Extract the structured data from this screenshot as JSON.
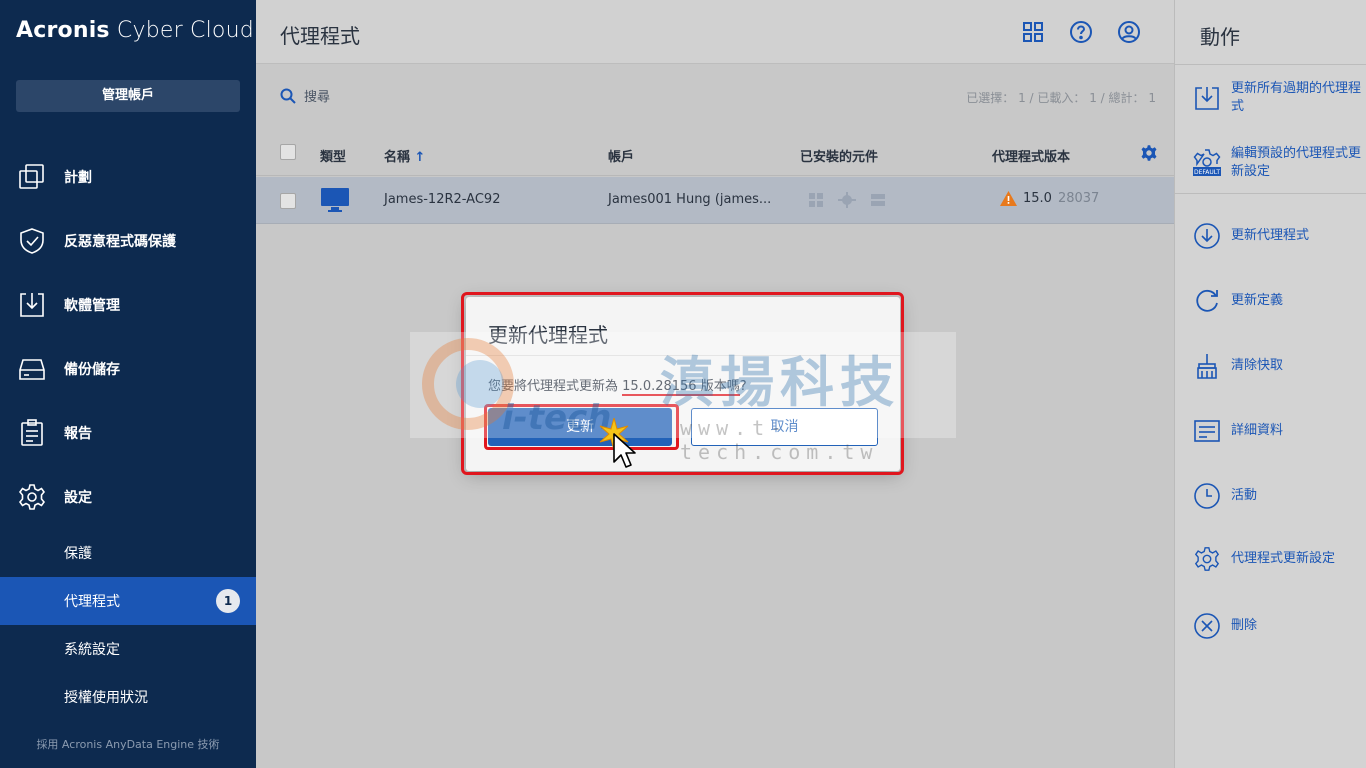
{
  "brand": {
    "bold": "Acronis",
    "light": " Cyber Cloud"
  },
  "sidebar": {
    "manage_button": "管理帳戶",
    "items": [
      {
        "label": "計劃",
        "icon": "plans-icon"
      },
      {
        "label": "反惡意程式碼保護",
        "icon": "shield-icon"
      },
      {
        "label": "軟體管理",
        "icon": "software-icon"
      },
      {
        "label": "備份儲存",
        "icon": "storage-icon"
      },
      {
        "label": "報告",
        "icon": "report-icon"
      },
      {
        "label": "設定",
        "icon": "gear-icon"
      }
    ],
    "sub_items": [
      {
        "label": "保護"
      },
      {
        "label": "代理程式",
        "badge": "1",
        "active": true
      },
      {
        "label": "系統設定"
      },
      {
        "label": "授權使用狀況"
      }
    ],
    "footer": "採用 Acronis AnyData Engine 技術"
  },
  "main": {
    "title": "代理程式",
    "search_label": "搜尋",
    "stats": "已選擇： 1 / 已載入： 1 / 總計： 1",
    "columns": {
      "type": "類型",
      "name": "名稱",
      "account": "帳戶",
      "components": "已安裝的元件",
      "version": "代理程式版本"
    },
    "rows": [
      {
        "name": "James-12R2-AC92",
        "account": "James001 Hung (james...",
        "version": "15.0",
        "build": "28037"
      }
    ]
  },
  "actions": {
    "title": "動作",
    "items": [
      {
        "label": "更新所有過期的代理程式",
        "icon": "update-all-icon"
      },
      {
        "label": "編輯預設的代理程式更新設定",
        "icon": "default-settings-icon"
      },
      {
        "label": "更新代理程式",
        "icon": "download-circle-icon"
      },
      {
        "label": "更新定義",
        "icon": "refresh-icon"
      },
      {
        "label": "清除快取",
        "icon": "broom-icon"
      },
      {
        "label": "詳細資料",
        "icon": "details-icon"
      },
      {
        "label": "活動",
        "icon": "clock-icon"
      },
      {
        "label": "代理程式更新設定",
        "icon": "gear-icon"
      },
      {
        "label": "刪除",
        "icon": "delete-icon"
      }
    ]
  },
  "dialog": {
    "title": "更新代理程式",
    "message_prefix": "您要將代理程式更新為 ",
    "message_highlight": "15.0.28156 版本嗎",
    "message_suffix": "?",
    "ok_label": "更新",
    "cancel_label": "取消"
  },
  "watermark": {
    "chinese": "滇揚科技",
    "tech": "i-tech",
    "url": "www.t-tech.com.tw"
  },
  "colors": {
    "sidebar": "#0d2a4f",
    "accent": "#1b56b5",
    "highlight": "#e0161e",
    "warning": "#e8791c"
  }
}
